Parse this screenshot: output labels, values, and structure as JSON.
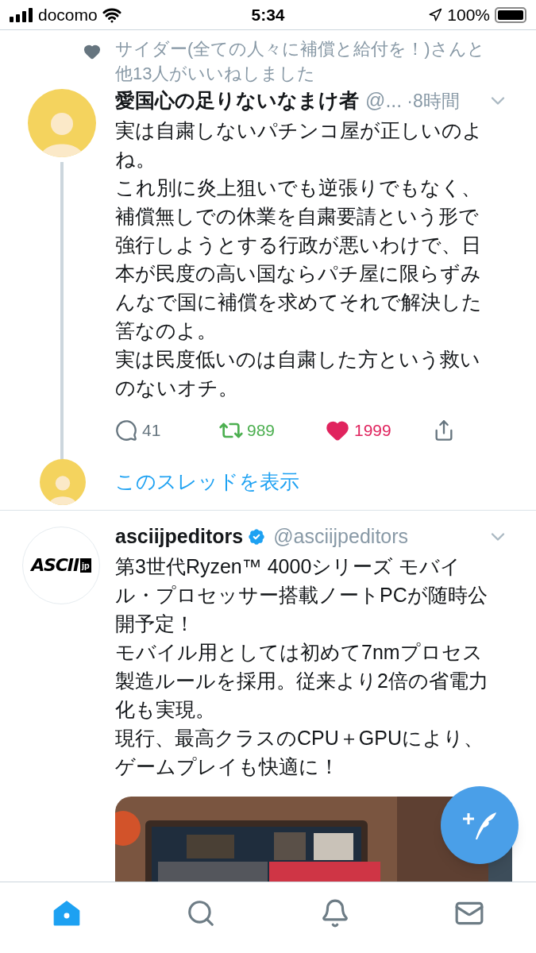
{
  "status_bar": {
    "carrier": "docomo",
    "time": "5:34",
    "battery": "100%"
  },
  "feed": [
    {
      "social_context": "サイダー(全ての人々に補償と給付を！)さんと他13人がいいねしました",
      "author": {
        "name": "愛国心の足りないなまけ者",
        "handle": "@...",
        "verified": false
      },
      "time": "·8時間",
      "paragraphs": [
        "実は自粛しないパチンコ屋が正しいのよね。",
        "これ別に炎上狙いでも逆張りでもなく、補償無しでの休業を自粛要請という形で強行しようとする行政が悪いわけで、日本が民度の高い国ならパチ屋に限らずみんなで国に補償を求めてそれで解決した筈なのよ。",
        "実は民度低いのは自粛した方という救いのないオチ。"
      ],
      "actions": {
        "replies": "41",
        "retweets": "989",
        "retweeted": true,
        "likes": "1999",
        "liked": true
      },
      "thread_link": "このスレッドを表示"
    },
    {
      "author": {
        "name": "asciijpeditors",
        "handle": "@asciijpeditors",
        "verified": true,
        "logo": {
          "text": "ASCII",
          "badge": "jp"
        }
      },
      "paragraphs": [
        "第3世代Ryzen™ 4000シリーズ モバイル・プロセッサー搭載ノートPCが随時公開予定！",
        "モバイル用としては初めて7nmプロセス製造ルールを採用。従来より2倍の省電力化も実現。",
        "現行、最高クラスのCPU＋GPUにより、ゲームプレイも快適に！"
      ],
      "media": {
        "kind": "picture"
      }
    }
  ],
  "nav": [
    {
      "kind": "home",
      "selected": true
    },
    {
      "kind": "search",
      "selected": false
    },
    {
      "kind": "bell",
      "selected": false
    },
    {
      "kind": "mail",
      "selected": false
    }
  ]
}
